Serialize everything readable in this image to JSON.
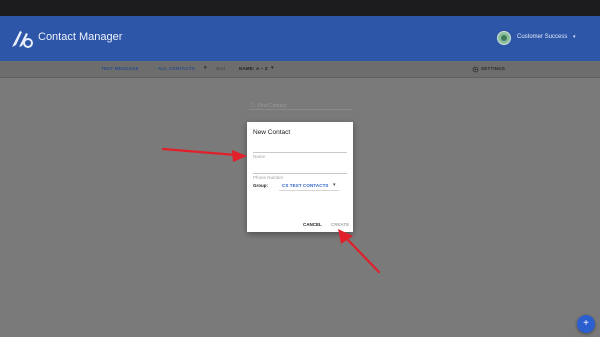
{
  "app": {
    "title": "Contact Manager"
  },
  "account": {
    "name": "Customer Success",
    "caret": "▾"
  },
  "toolbar": {
    "text_message": "TEXT MESSAGE",
    "filter_value": "ALL CONTACTS",
    "sort_label": "Sort",
    "sort_value": "NAME: A – Z",
    "settings": "SETTINGS",
    "caret": "▾"
  },
  "search": {
    "placeholder": "Find Contact"
  },
  "modal": {
    "title": "New Contact",
    "name_placeholder": "Name",
    "phone_placeholder": "Phone Number",
    "group_label": "Group:",
    "group_value": "CS TEXT CONTACTS",
    "group_caret": "▾",
    "cancel": "CANCEL",
    "create": "CREATE"
  },
  "fab": {
    "label": "+"
  },
  "colors": {
    "header": "#2d55a8",
    "accent": "#2d62c4",
    "annotation_arrow": "#e0202a",
    "overlay": "#7a7a7a"
  },
  "icons": [
    "app-logo-icon",
    "avatar-icon",
    "gear-icon",
    "search-icon",
    "plus-icon",
    "annotation-arrow"
  ]
}
